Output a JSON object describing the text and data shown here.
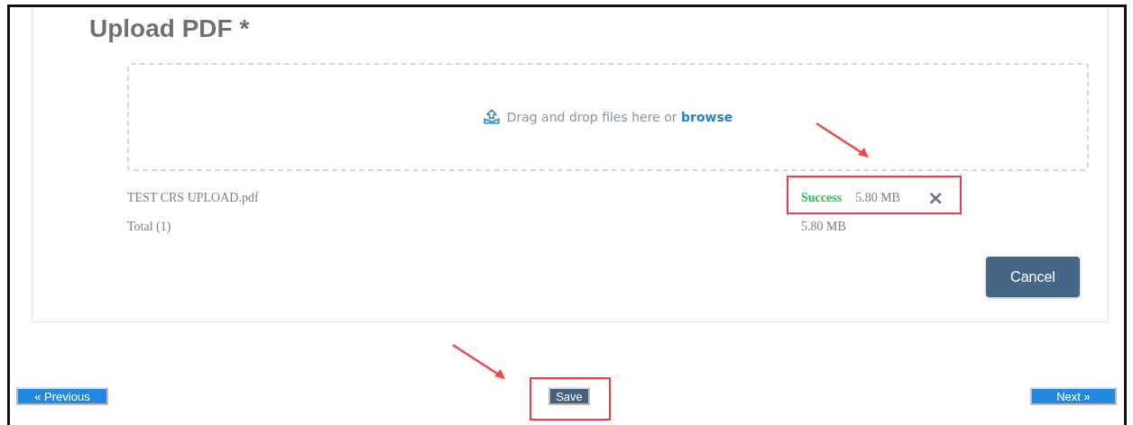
{
  "upload": {
    "title": "Upload PDF *",
    "dropzone": {
      "text": "Drag and drop files here or ",
      "link": "browse"
    },
    "files": [
      {
        "name": "TEST CRS UPLOAD.pdf",
        "status": {
          "text": "Success",
          "kind": "success"
        },
        "size": "5.80 MB",
        "remove": "×"
      }
    ],
    "total": {
      "label": "Total (1)",
      "size": "5.80 MB"
    },
    "cancel": "Cancel"
  },
  "nav": {
    "previous": "« Previous",
    "save": "Save",
    "next": "Next »"
  }
}
